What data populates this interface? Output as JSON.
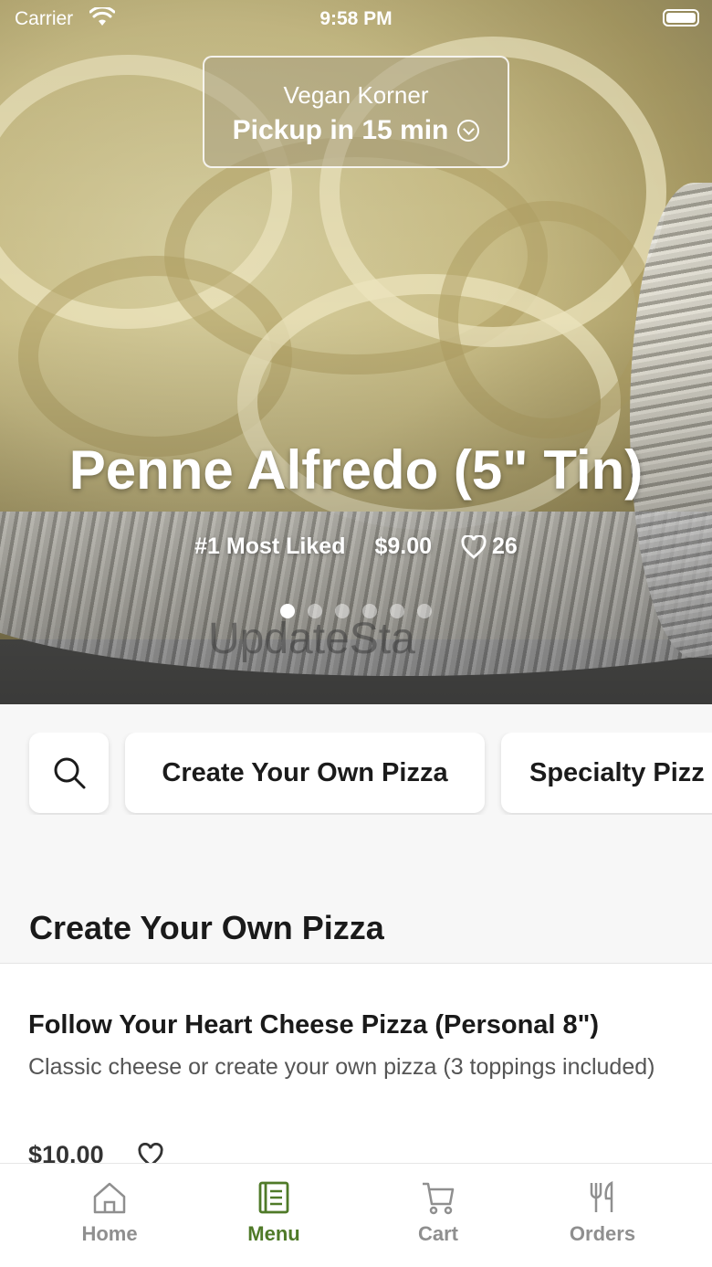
{
  "status_bar": {
    "carrier": "Carrier",
    "time": "9:58 PM"
  },
  "store": {
    "name": "Vegan Korner",
    "pickup": "Pickup in 15 min"
  },
  "hero": {
    "title": "Penne Alfredo (5\" Tin)",
    "rank": "#1 Most Liked",
    "price": "$9.00",
    "likes": "26",
    "watermark": "UpdateSta",
    "carousel_dots": 6,
    "active_dot": 0
  },
  "categories": [
    {
      "label": "Create Your Own Pizza"
    },
    {
      "label": "Specialty Pizz"
    }
  ],
  "section": {
    "title": "Create Your Own Pizza"
  },
  "item": {
    "name": "Follow Your Heart Cheese Pizza (Personal 8\")",
    "description": "Classic cheese or create your own pizza (3 toppings included)",
    "price": "$10.00"
  },
  "tabs": [
    {
      "label": "Home",
      "icon": "home-icon",
      "active": false
    },
    {
      "label": "Menu",
      "icon": "menu-book-icon",
      "active": true
    },
    {
      "label": "Cart",
      "icon": "cart-icon",
      "active": false
    },
    {
      "label": "Orders",
      "icon": "fork-knife-icon",
      "active": false
    }
  ],
  "colors": {
    "accent": "#4f7a28",
    "inactive": "#8f8f8f"
  }
}
